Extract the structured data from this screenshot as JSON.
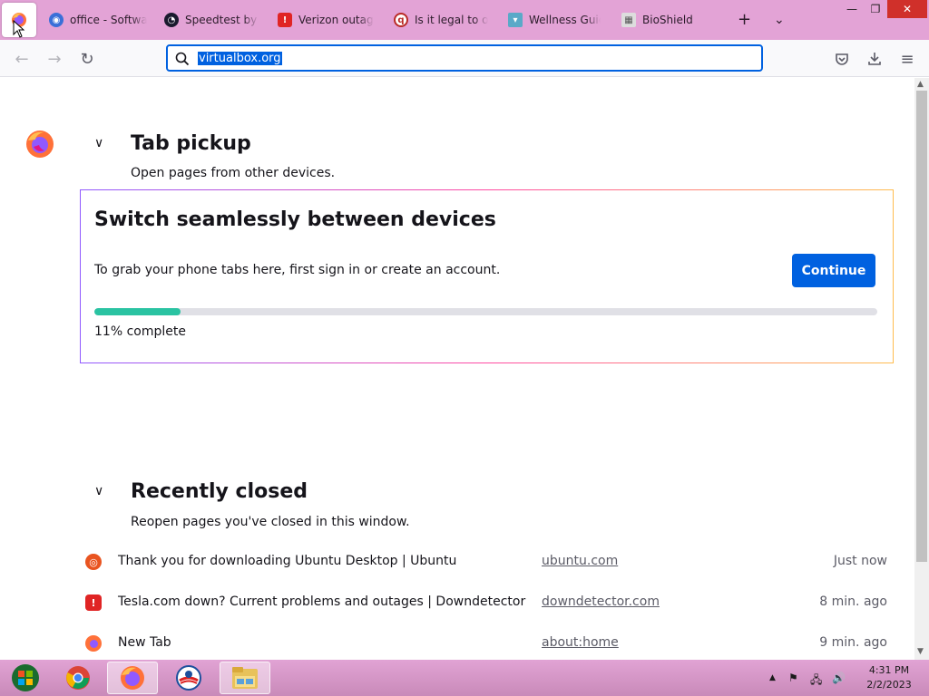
{
  "browser": {
    "tabs": [
      {
        "label": "office - Software",
        "icon": "office-site-icon",
        "color": "#3a6fd8"
      },
      {
        "label": "Speedtest by Ookla",
        "icon": "speedtest-icon",
        "color": "#1a1a2e"
      },
      {
        "label": "Verizon outage or",
        "icon": "downdetector-icon",
        "color": "#e02424"
      },
      {
        "label": "Is it legal to own",
        "icon": "quora-icon",
        "color": "#b92b27"
      },
      {
        "label": "Wellness Guide",
        "icon": "wellness-icon",
        "color": "#5aa9c8"
      },
      {
        "label": "BioShield",
        "icon": "bioshield-icon",
        "color": "#888888"
      }
    ],
    "url": "virtualbox.org"
  },
  "tab_pickup": {
    "heading": "Tab pickup",
    "subheading": "Open pages from other devices.",
    "card_title": "Switch seamlessly between devices",
    "card_text": "To grab your phone tabs here, first sign in or create an account.",
    "continue_label": "Continue",
    "progress_percent": 11,
    "progress_text": "11% complete"
  },
  "recently_closed": {
    "heading": "Recently closed",
    "subheading": "Reopen pages you've closed in this window.",
    "items": [
      {
        "title": "Thank you for downloading Ubuntu Desktop | Ubuntu",
        "domain": "ubuntu.com",
        "time": "Just now",
        "icon": "ubuntu-icon",
        "color": "#e95420"
      },
      {
        "title": "Tesla.com down? Current problems and outages | Downdetector",
        "domain": "downdetector.com",
        "time": "8 min. ago",
        "icon": "downdetector-icon",
        "color": "#e02424"
      },
      {
        "title": "New Tab",
        "domain": "about:home",
        "time": "9 min. ago",
        "icon": "firefox-icon",
        "color": "#ff7139"
      }
    ]
  },
  "taskbar": {
    "time": "4:31 PM",
    "date": "2/2/2023"
  }
}
